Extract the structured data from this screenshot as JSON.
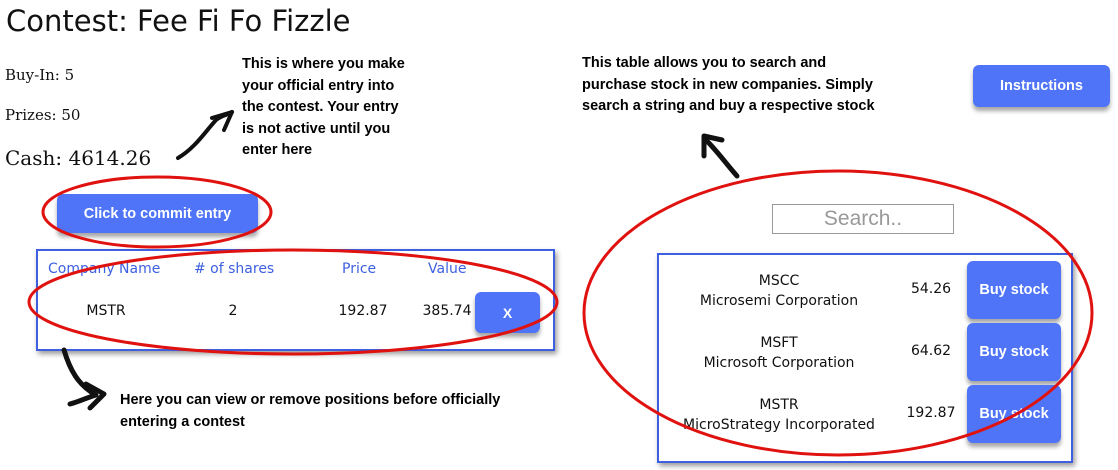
{
  "contest": {
    "title": "Contest: Fee Fi Fo Fizzle",
    "buy_in": "Buy-In: 5",
    "prizes": "Prizes: 50",
    "cash": "Cash: 4614.26",
    "commit_label": "Click to commit entry"
  },
  "annotations": {
    "entry_note": [
      "This is where you make",
      "your official entry into",
      "the contest. Your entry",
      "is not active until you",
      "enter here"
    ],
    "search_note": [
      "This table allows you to search and",
      "purchase stock in new companies. Simply",
      "search a string and buy a respective stock"
    ],
    "positions_note": [
      "Here you can view or remove positions before officially",
      "entering a contest"
    ]
  },
  "instructions_label": "Instructions",
  "positions": {
    "headers": [
      "Company Name",
      "# of shares",
      "Price",
      "Value"
    ],
    "rows": [
      {
        "company": "MSTR",
        "shares": "2",
        "price": "192.87",
        "value": "385.74",
        "remove_label": "X"
      }
    ]
  },
  "search": {
    "placeholder": "Search.."
  },
  "results": [
    {
      "symbol": "MSCC",
      "name": "Microsemi Corporation",
      "price": "54.26",
      "buy_label": "Buy stock"
    },
    {
      "symbol": "MSFT",
      "name": "Microsoft Corporation",
      "price": "64.62",
      "buy_label": "Buy stock"
    },
    {
      "symbol": "MSTR",
      "name": "MicroStrategy Incorporated",
      "price": "192.87",
      "buy_label": "Buy stock"
    }
  ],
  "colors": {
    "accent": "#4f74f7",
    "panel_border": "#3d5fe0",
    "annotation": "#e0120f"
  }
}
